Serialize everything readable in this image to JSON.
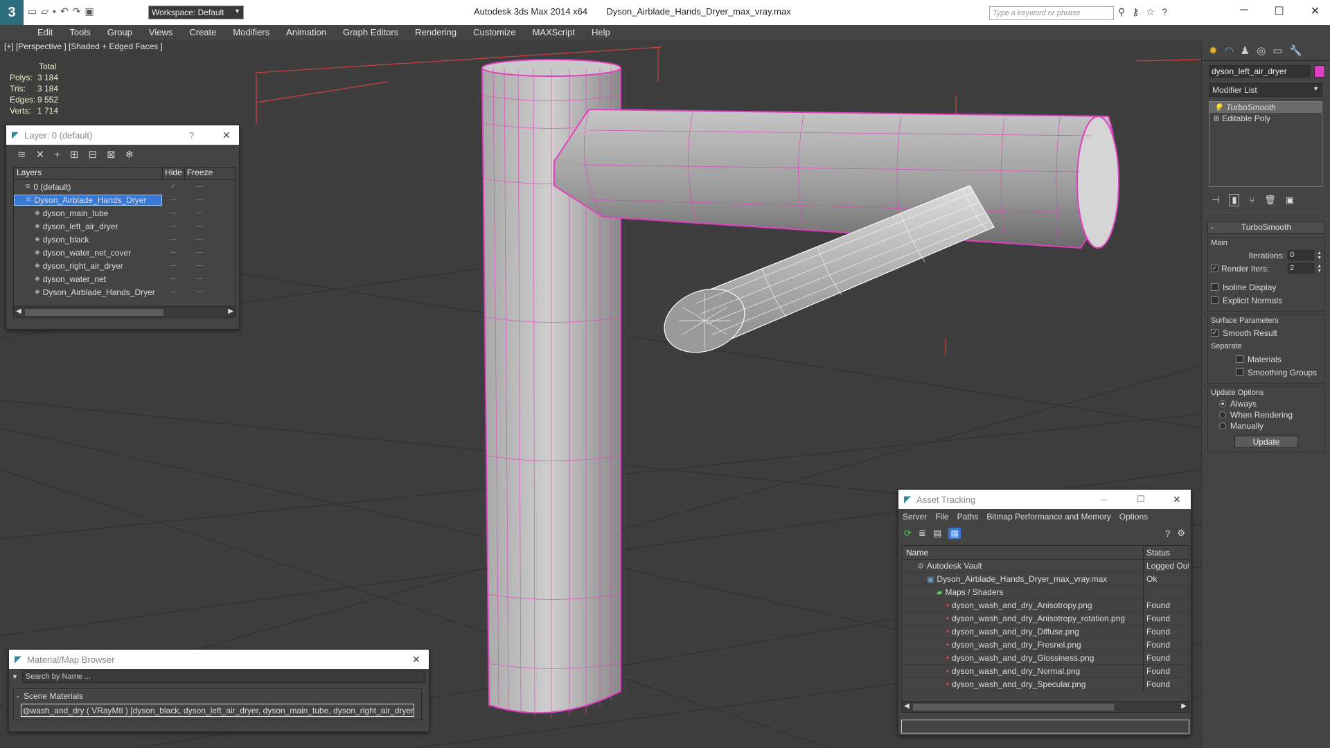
{
  "title": {
    "app": "Autodesk 3ds Max  2014 x64",
    "file": "Dyson_Airblade_Hands_Dryer_max_vray.max",
    "workspace": "Workspace: Default",
    "search_placeholder": "Type a keyword or phrase"
  },
  "menu": [
    "Edit",
    "Tools",
    "Group",
    "Views",
    "Create",
    "Modifiers",
    "Animation",
    "Graph Editors",
    "Rendering",
    "Customize",
    "MAXScript",
    "Help"
  ],
  "viewport": {
    "label": "[+] [Perspective ] [Shaded + Edged Faces ]",
    "stats": {
      "header": "Total",
      "polys_label": "Polys:",
      "polys": "3 184",
      "tris_label": "Tris:",
      "tris": "3 184",
      "edges_label": "Edges:",
      "edges": "9 552",
      "verts_label": "Verts:",
      "verts": "1 714"
    }
  },
  "layer_window": {
    "title": "Layer: 0 (default)",
    "help": "?",
    "col_layers": "Layers",
    "col_hide": "Hide",
    "col_freeze": "Freeze",
    "rows": [
      {
        "name": "0 (default)",
        "level": 0,
        "selected": false
      },
      {
        "name": "Dyson_Airblade_Hands_Dryer",
        "level": 0,
        "selected": true
      },
      {
        "name": "dyson_main_tube",
        "level": 1,
        "selected": false
      },
      {
        "name": "dyson_left_air_dryer",
        "level": 1,
        "selected": false
      },
      {
        "name": "dyson_black",
        "level": 1,
        "selected": false
      },
      {
        "name": "dyson_water_net_cover",
        "level": 1,
        "selected": false
      },
      {
        "name": "dyson_right_air_dryer",
        "level": 1,
        "selected": false
      },
      {
        "name": "dyson_water_net",
        "level": 1,
        "selected": false
      },
      {
        "name": "Dyson_Airblade_Hands_Dryer",
        "level": 1,
        "selected": false
      }
    ]
  },
  "material_browser": {
    "title": "Material/Map Browser",
    "search_placeholder": "Search by Name ...",
    "section": "Scene Materials",
    "item": "wash_and_dry ( VRayMtl ) [dyson_black, dyson_left_air_dryer, dyson_main_tube, dyson_right_air_dryer,..."
  },
  "asset_tracking": {
    "title": "Asset Tracking",
    "menu": [
      "Server",
      "File",
      "Paths",
      "Bitmap Performance and Memory",
      "Options"
    ],
    "col_name": "Name",
    "col_status": "Status",
    "rows": [
      {
        "name": "Autodesk Vault",
        "status": "Logged Out",
        "level": 1,
        "icon": "vault"
      },
      {
        "name": "Dyson_Airblade_Hands_Dryer_max_vray.max",
        "status": "Ok",
        "level": 2,
        "icon": "max"
      },
      {
        "name": "Maps / Shaders",
        "status": "",
        "level": 3,
        "icon": "folder"
      },
      {
        "name": "dyson_wash_and_dry_Anisotropy.png",
        "status": "Found",
        "level": 4,
        "icon": "png"
      },
      {
        "name": "dyson_wash_and_dry_Anisotropy_rotation.png",
        "status": "Found",
        "level": 4,
        "icon": "png"
      },
      {
        "name": "dyson_wash_and_dry_Diffuse.png",
        "status": "Found",
        "level": 4,
        "icon": "png"
      },
      {
        "name": "dyson_wash_and_dry_Fresnel.png",
        "status": "Found",
        "level": 4,
        "icon": "png"
      },
      {
        "name": "dyson_wash_and_dry_Glossiness.png",
        "status": "Found",
        "level": 4,
        "icon": "png"
      },
      {
        "name": "dyson_wash_and_dry_Normal.png",
        "status": "Found",
        "level": 4,
        "icon": "png"
      },
      {
        "name": "dyson_wash_and_dry_Specular.png",
        "status": "Found",
        "level": 4,
        "icon": "png"
      }
    ]
  },
  "command_panel": {
    "object_name": "dyson_left_air_dryer",
    "object_color": "#e040c0",
    "modifier_list": "Modifier List",
    "stack": [
      {
        "name": "TurboSmooth",
        "italic": true
      },
      {
        "name": "Editable Poly",
        "italic": false
      }
    ],
    "rollout_title": "TurboSmooth",
    "main_group": "Main",
    "iterations_label": "Iterations:",
    "iterations": "0",
    "render_iters_label": "Render Iters:",
    "render_iters": "2",
    "isoline": "Isoline Display",
    "explicit_normals": "Explicit Normals",
    "surface_params": "Surface Parameters",
    "smooth_result": "Smooth Result",
    "separate": "Separate",
    "materials": "Materials",
    "smoothing_groups": "Smoothing Groups",
    "update_options": "Update Options",
    "always": "Always",
    "when_rendering": "When Rendering",
    "manually": "Manually",
    "update_button": "Update"
  },
  "colors": {
    "selection": "#e040c0",
    "layer_highlight": "#3a78d6",
    "viewport_bg": "#3e3e3e"
  }
}
